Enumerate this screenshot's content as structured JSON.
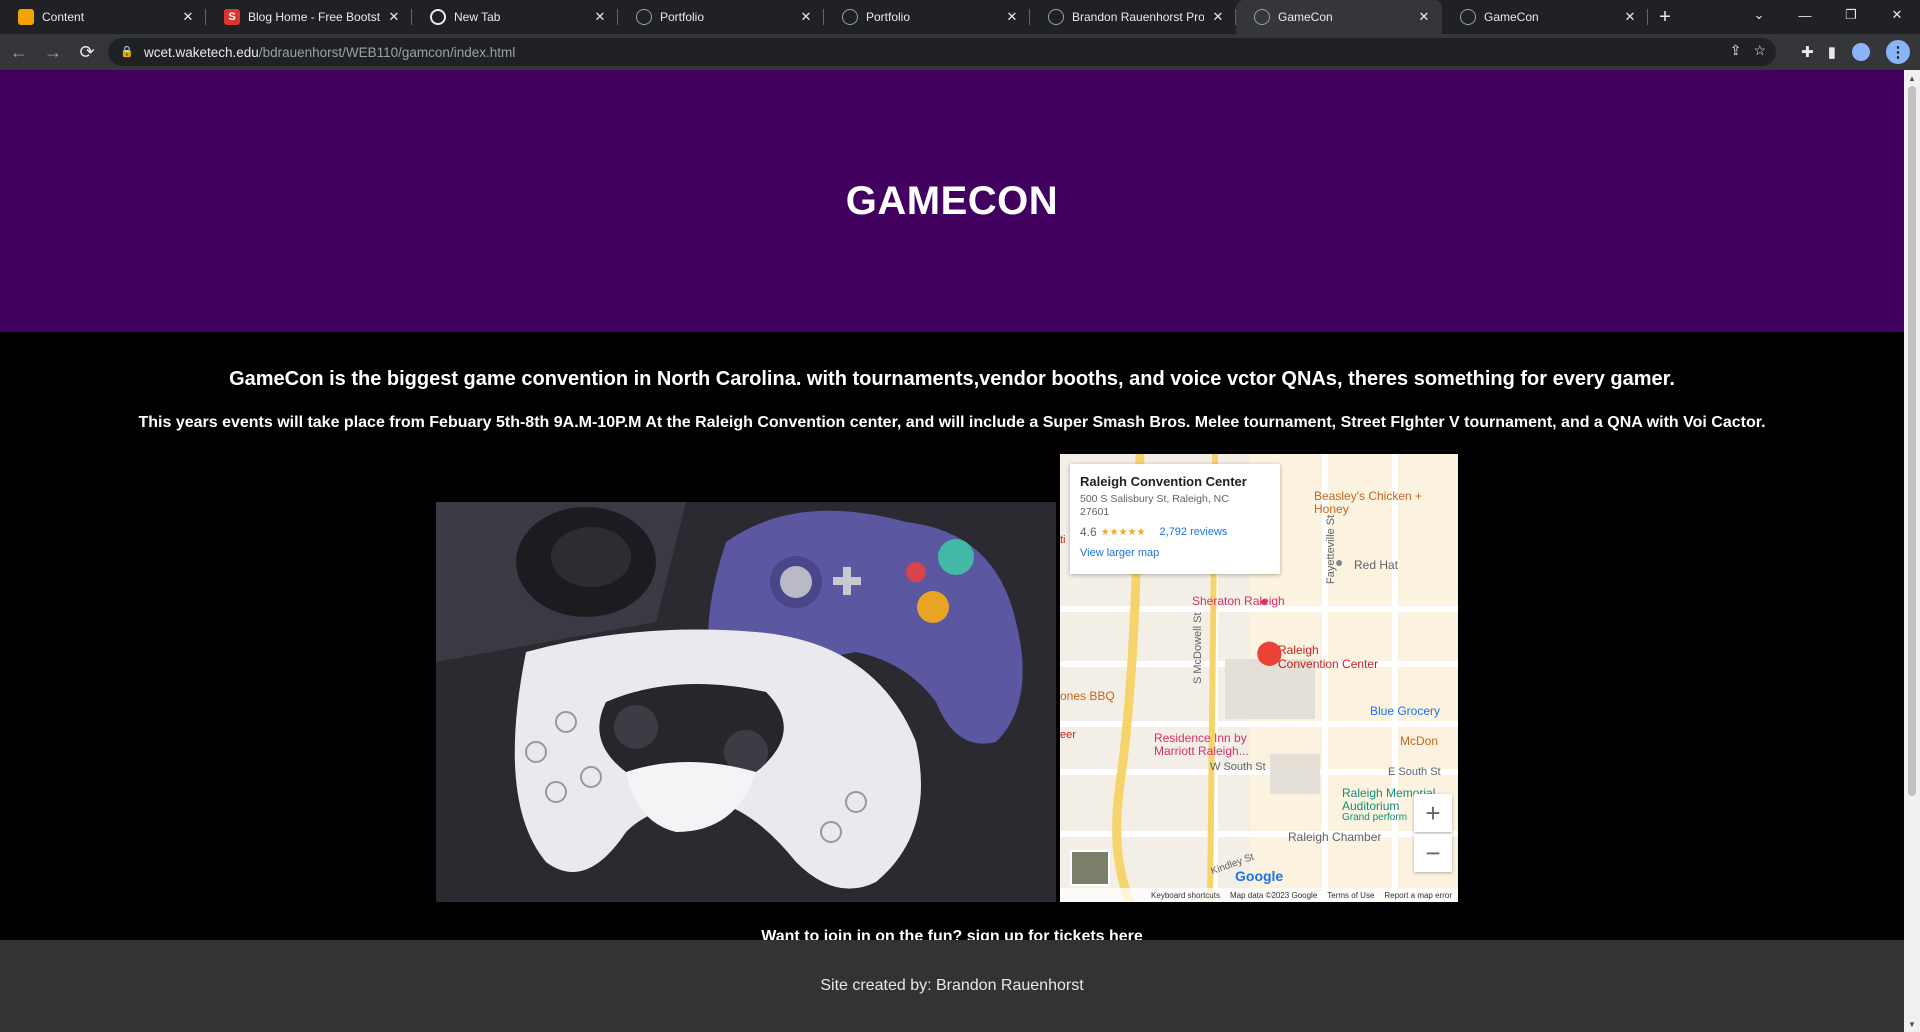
{
  "browser": {
    "tabs": [
      {
        "title": "Content",
        "favicon": "orange-edit-icon",
        "color": "#f4a300"
      },
      {
        "title": "Blog Home - Free Bootstra",
        "favicon": "startbootstrap-icon",
        "color": "#dd3333"
      },
      {
        "title": "New Tab",
        "favicon": "chrome-icon",
        "color": "#e8eaed"
      },
      {
        "title": "Portfolio",
        "favicon": "globe-icon",
        "color": "#9aa0a6"
      },
      {
        "title": "Portfolio",
        "favicon": "globe-icon",
        "color": "#9aa0a6"
      },
      {
        "title": "Brandon Rauenhorst Proje",
        "favicon": "globe-icon",
        "color": "#9aa0a6"
      },
      {
        "title": "GameCon",
        "favicon": "globe-icon",
        "color": "#9aa0a6",
        "active": true
      },
      {
        "title": "GameCon",
        "favicon": "globe-icon",
        "color": "#9aa0a6"
      }
    ],
    "url_host": "wcet.waketech.edu",
    "url_path": "/bdrauenhorst/WEB110/gamcon/index.html"
  },
  "page": {
    "header_title": "GAMECON",
    "intro": "GameCon is the biggest game convention in North Carolina. with tournaments,vendor booths, and voice vctor QNAs, theres something for every gamer.",
    "details": "This years events will take place from Febuary 5th-8th 9A.M-10P.M At the Raleigh Convention center, and will include a Super Smash Bros. Melee tournament, Street FIghter V tournament, and a QNA with Voi Cactor.",
    "signup": "Want to join in on the fun? sign up for tickets here",
    "footer": "Site created by: Brandon Rauenhorst",
    "colors": {
      "header_bg": "#42005f",
      "body_bg": "#000000",
      "footer_bg": "#333333"
    }
  },
  "map": {
    "place_name": "Raleigh Convention Center",
    "address": "500 S Salisbury St, Raleigh, NC 27601",
    "rating": "4.6",
    "stars": "★★★★★",
    "reviews": "2,792 reviews",
    "view_larger": "View larger map",
    "labels": {
      "beasleys": "Beasley's Chicken + Honey",
      "red_hat": "Red Hat",
      "sheraton": "Sheraton Raleigh",
      "rcc_1": "Raleigh",
      "rcc_2": "Convention Center",
      "jones_bbq": "ones BBQ",
      "blue_grocery": "Blue Grocery",
      "residence_inn": "Residence Inn by",
      "marriott": "Marriott Raleigh...",
      "w_south": "W South St",
      "e_south": "E South St",
      "memorial": "Raleigh Memorial",
      "auditorium": "Auditorium",
      "grand": "Grand perform",
      "chamber": "Raleigh Chamber",
      "mcdowell": "S McDowell St",
      "fayetteville": "Fayetteville St",
      "kindley": "Kindley St",
      "mcdon": "McDon",
      "ti": "ti",
      "eer": "eer"
    },
    "zoom_in": "+",
    "zoom_out": "−",
    "google": "Google",
    "footer": [
      "Keyboard shortcuts",
      "Map data ©2023 Google",
      "Terms of Use",
      "Report a map error"
    ]
  }
}
